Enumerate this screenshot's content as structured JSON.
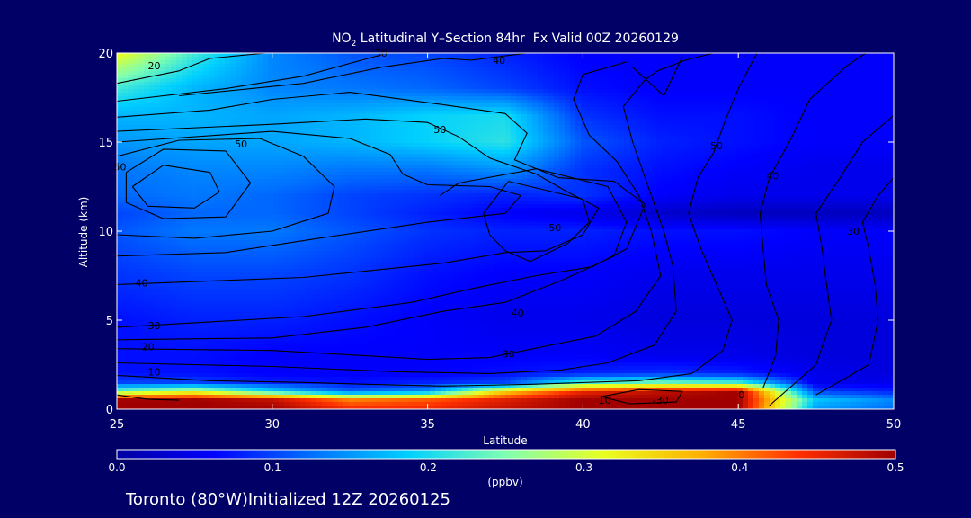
{
  "chart_data": {
    "type": "heatmap",
    "title_prefix": "NO",
    "title_sub": "2",
    "title_rest": " Latitudinal Y–Section 84hr  Fx Valid 00Z 20260129",
    "xlabel": "Latitude",
    "ylabel": "Altitude (km)",
    "xlim": [
      25,
      50
    ],
    "ylim": [
      0,
      20
    ],
    "x_ticks": [
      25,
      30,
      35,
      40,
      45,
      50
    ],
    "y_ticks": [
      0,
      5,
      10,
      15,
      20
    ],
    "colorbar": {
      "min": 0.0,
      "max": 0.5,
      "ticks": [
        "0.0",
        "0.1",
        "0.2",
        "0.3",
        "0.4",
        "0.5"
      ],
      "unit": "(ppbv)",
      "colors": [
        "#0000a0",
        "#0000ff",
        "#0070ff",
        "#00d0ff",
        "#80ffb0",
        "#e8ff20",
        "#ffb000",
        "#ff3000",
        "#a00000"
      ]
    },
    "field_grid": {
      "lats": [
        25,
        27.5,
        30,
        32.5,
        35,
        37.5,
        40,
        42.5,
        45,
        47.5,
        50
      ],
      "alts": [
        0,
        0.5,
        1,
        1.5,
        2,
        3,
        5,
        7.5,
        10,
        11,
        12,
        13.5,
        15,
        16.5,
        18,
        20
      ],
      "values": [
        [
          0.5,
          0.5,
          0.5,
          0.45,
          0.45,
          0.48,
          0.5,
          0.5,
          0.5,
          0.15,
          0.12
        ],
        [
          0.5,
          0.5,
          0.48,
          0.4,
          0.42,
          0.46,
          0.5,
          0.5,
          0.5,
          0.18,
          0.14
        ],
        [
          0.25,
          0.3,
          0.2,
          0.12,
          0.15,
          0.35,
          0.45,
          0.48,
          0.5,
          0.1,
          0.08
        ],
        [
          0.1,
          0.1,
          0.08,
          0.07,
          0.08,
          0.1,
          0.22,
          0.24,
          0.22,
          0.05,
          0.05
        ],
        [
          0.07,
          0.07,
          0.06,
          0.06,
          0.06,
          0.07,
          0.08,
          0.09,
          0.08,
          0.05,
          0.04
        ],
        [
          0.07,
          0.07,
          0.06,
          0.06,
          0.06,
          0.06,
          0.06,
          0.05,
          0.05,
          0.04,
          0.04
        ],
        [
          0.07,
          0.08,
          0.08,
          0.07,
          0.06,
          0.05,
          0.05,
          0.04,
          0.04,
          0.04,
          0.04
        ],
        [
          0.09,
          0.1,
          0.1,
          0.09,
          0.07,
          0.06,
          0.06,
          0.05,
          0.05,
          0.05,
          0.05
        ],
        [
          0.11,
          0.13,
          0.13,
          0.11,
          0.09,
          0.08,
          0.08,
          0.07,
          0.07,
          0.06,
          0.06
        ],
        [
          0.1,
          0.12,
          0.12,
          0.1,
          0.08,
          0.06,
          0.05,
          0.03,
          0.02,
          0.02,
          0.02
        ],
        [
          0.12,
          0.13,
          0.12,
          0.1,
          0.09,
          0.08,
          0.09,
          0.06,
          0.05,
          0.05,
          0.05
        ],
        [
          0.13,
          0.14,
          0.14,
          0.13,
          0.13,
          0.15,
          0.09,
          0.07,
          0.06,
          0.05,
          0.05
        ],
        [
          0.15,
          0.16,
          0.16,
          0.17,
          0.19,
          0.21,
          0.11,
          0.08,
          0.07,
          0.06,
          0.06
        ],
        [
          0.17,
          0.17,
          0.16,
          0.17,
          0.19,
          0.2,
          0.09,
          0.07,
          0.07,
          0.06,
          0.06
        ],
        [
          0.22,
          0.17,
          0.14,
          0.13,
          0.12,
          0.1,
          0.07,
          0.06,
          0.06,
          0.06,
          0.06
        ],
        [
          0.32,
          0.22,
          0.14,
          0.11,
          0.1,
          0.08,
          0.06,
          0.06,
          0.06,
          0.06,
          0.06
        ]
      ]
    },
    "contour_labels": [
      {
        "text": "20",
        "lat": 26.2,
        "alt": 19.3
      },
      {
        "text": "30",
        "lat": 33.5,
        "alt": 20.0
      },
      {
        "text": "40",
        "lat": 37.3,
        "alt": 19.6
      },
      {
        "text": "50",
        "lat": 29.0,
        "alt": 14.9
      },
      {
        "text": "50",
        "lat": 35.4,
        "alt": 15.7
      },
      {
        "text": "50",
        "lat": 39.1,
        "alt": 10.2
      },
      {
        "text": "50",
        "lat": 25.1,
        "alt": 13.6
      },
      {
        "text": "40",
        "lat": 25.8,
        "alt": 7.1
      },
      {
        "text": "30",
        "lat": 26.2,
        "alt": 4.7
      },
      {
        "text": "20",
        "lat": 26.0,
        "alt": 3.5
      },
      {
        "text": "10",
        "lat": 26.2,
        "alt": 2.1
      },
      {
        "text": "40",
        "lat": 37.9,
        "alt": 5.4
      },
      {
        "text": "30",
        "lat": 37.6,
        "alt": 3.1
      },
      {
        "text": "10",
        "lat": 40.7,
        "alt": 0.5
      },
      {
        "text": "-30",
        "lat": 42.5,
        "alt": 0.5
      },
      {
        "text": "0",
        "lat": 45.1,
        "alt": 0.8
      },
      {
        "text": "50",
        "lat": 44.3,
        "alt": 14.8
      },
      {
        "text": "40",
        "lat": 46.1,
        "alt": 13.1
      },
      {
        "text": "30",
        "lat": 48.7,
        "alt": 10.0
      }
    ],
    "wind_contours": [
      [
        [
          25.5,
          12.5
        ],
        [
          26.5,
          13.7
        ],
        [
          28,
          13.3
        ],
        [
          28.3,
          12.2
        ],
        [
          27.5,
          11.3
        ],
        [
          26,
          11.4
        ],
        [
          25.5,
          12.5
        ]
      ],
      [
        [
          25.3,
          13.3
        ],
        [
          26.5,
          14.6
        ],
        [
          28.5,
          14.5
        ],
        [
          29.3,
          12.7
        ],
        [
          28.5,
          10.8
        ],
        [
          26.5,
          10.7
        ],
        [
          25.3,
          11.6
        ],
        [
          25.3,
          13.3
        ]
      ],
      [
        [
          25,
          14.2
        ],
        [
          27,
          15.1
        ],
        [
          29.6,
          15.2
        ],
        [
          31,
          14.2
        ],
        [
          32,
          12.5
        ],
        [
          31.8,
          11
        ],
        [
          30,
          10
        ],
        [
          27.5,
          9.6
        ],
        [
          25,
          9.8
        ]
      ],
      [
        [
          25,
          15
        ],
        [
          30,
          15.6
        ],
        [
          32.5,
          15.2
        ],
        [
          33.8,
          14.3
        ],
        [
          34.2,
          13.2
        ],
        [
          35,
          12.6
        ],
        [
          37,
          12.5
        ],
        [
          38,
          12
        ],
        [
          37.5,
          11
        ],
        [
          35,
          10.5
        ],
        [
          31.5,
          9.6
        ],
        [
          28.5,
          8.8
        ],
        [
          25,
          8.6
        ]
      ],
      [
        [
          25,
          15.6
        ],
        [
          30,
          16
        ],
        [
          33,
          16.3
        ],
        [
          35,
          16.1
        ],
        [
          36,
          15.3
        ],
        [
          37,
          14.1
        ],
        [
          38.5,
          13.2
        ],
        [
          39.5,
          12.2
        ],
        [
          40.5,
          11.3
        ],
        [
          40,
          9.8
        ],
        [
          38.8,
          8.9
        ],
        [
          37.5,
          8.8
        ],
        [
          35.5,
          8.2
        ],
        [
          31,
          7.4
        ],
        [
          25,
          7.0
        ]
      ],
      [
        [
          25,
          16.4
        ],
        [
          28,
          16.8
        ],
        [
          30,
          17.4
        ],
        [
          32.5,
          17.8
        ],
        [
          35.5,
          17.1
        ],
        [
          37.5,
          16.6
        ],
        [
          38.2,
          15.5
        ],
        [
          37.8,
          14.0
        ],
        [
          39.2,
          13.0
        ],
        [
          41,
          12.8
        ],
        [
          42,
          11.5
        ],
        [
          41.4,
          9.0
        ],
        [
          40.3,
          8.0
        ],
        [
          38.5,
          7.5
        ],
        [
          36.5,
          6.8
        ],
        [
          34.5,
          6.0
        ],
        [
          31,
          5.2
        ],
        [
          25,
          4.6
        ]
      ],
      [
        [
          25,
          17.3
        ],
        [
          28.5,
          18
        ],
        [
          31,
          18.7
        ],
        [
          33.5,
          19.9
        ]
      ],
      [
        [
          27,
          17.6
        ],
        [
          31,
          18.3
        ],
        [
          33.5,
          19.2
        ],
        [
          35.5,
          19.7
        ],
        [
          36.4,
          19.6
        ],
        [
          38.2,
          20.0
        ]
      ],
      [
        [
          25,
          18.3
        ],
        [
          27,
          19.0
        ],
        [
          28,
          19.7
        ],
        [
          29.8,
          20.0
        ]
      ],
      [
        [
          37.6,
          12.8
        ],
        [
          38.8,
          12.3
        ],
        [
          40,
          11.8
        ],
        [
          40.2,
          10.5
        ],
        [
          39.5,
          9.3
        ],
        [
          38.3,
          8.3
        ],
        [
          37.5,
          8.9
        ],
        [
          37.0,
          9.8
        ],
        [
          36.8,
          11.0
        ],
        [
          37.6,
          12.8
        ]
      ],
      [
        [
          35.4,
          12.0
        ],
        [
          36.0,
          12.7
        ],
        [
          38.5,
          13.5
        ],
        [
          40.8,
          12.5
        ],
        [
          41.4,
          10.5
        ],
        [
          41.0,
          8.6
        ],
        [
          39.4,
          7.3
        ],
        [
          37.5,
          6.0
        ],
        [
          35.5,
          5.5
        ],
        [
          33,
          4.6
        ],
        [
          30,
          4.0
        ],
        [
          25,
          3.9
        ]
      ],
      [
        [
          25,
          3.4
        ],
        [
          30,
          3.3
        ],
        [
          33,
          3.0
        ],
        [
          35,
          2.8
        ],
        [
          37,
          2.9
        ],
        [
          38.4,
          3.4
        ],
        [
          40.4,
          4.1
        ],
        [
          41.7,
          5.5
        ],
        [
          42.5,
          7.5
        ],
        [
          42.2,
          10.0
        ],
        [
          41.8,
          12.0
        ],
        [
          41.1,
          13.9
        ],
        [
          40.2,
          15.4
        ],
        [
          39.7,
          17.4
        ],
        [
          40.0,
          18.8
        ],
        [
          41.4,
          19.5
        ]
      ],
      [
        [
          25,
          2.6
        ],
        [
          30,
          2.4
        ],
        [
          34,
          2.1
        ],
        [
          37,
          2.0
        ],
        [
          39.3,
          2.2
        ],
        [
          40.8,
          2.6
        ],
        [
          42.3,
          3.6
        ],
        [
          43.0,
          5.5
        ],
        [
          42.9,
          8.0
        ],
        [
          42.6,
          10.0
        ],
        [
          42.0,
          13.0
        ],
        [
          41.6,
          15.0
        ],
        [
          41.3,
          17.0
        ],
        [
          42.0,
          18.5
        ],
        [
          42.4,
          19.0
        ],
        [
          43.3,
          19.6
        ],
        [
          44.2,
          20.0
        ]
      ],
      [
        [
          25,
          1.9
        ],
        [
          28,
          1.6
        ],
        [
          31,
          1.5
        ],
        [
          33,
          1.4
        ],
        [
          35.5,
          1.3
        ],
        [
          38.4,
          1.4
        ],
        [
          41.8,
          1.6
        ],
        [
          43.5,
          2.0
        ],
        [
          44.5,
          3.3
        ],
        [
          44.8,
          5.0
        ],
        [
          44.3,
          7.0
        ],
        [
          43.8,
          9.0
        ],
        [
          43.4,
          11.0
        ],
        [
          43.7,
          13.0
        ],
        [
          44.2,
          14.4
        ],
        [
          44.6,
          16.3
        ],
        [
          45.0,
          18.0
        ],
        [
          45.6,
          20.0
        ]
      ],
      [
        [
          45.8,
          1.2
        ],
        [
          46.2,
          3.0
        ],
        [
          46.3,
          5.0
        ],
        [
          45.9,
          7.0
        ],
        [
          45.8,
          9.0
        ],
        [
          45.7,
          11.0
        ],
        [
          46.0,
          13.0
        ],
        [
          46.7,
          15.2
        ],
        [
          47.3,
          17.4
        ],
        [
          48.5,
          19.3
        ],
        [
          49.1,
          20.0
        ]
      ],
      [
        [
          46.0,
          0.2
        ],
        [
          47.5,
          2.5
        ],
        [
          48.0,
          5.0
        ],
        [
          47.8,
          7.5
        ],
        [
          47.7,
          9.0
        ],
        [
          47.5,
          11.0
        ],
        [
          48.2,
          12.8
        ],
        [
          49.0,
          15.0
        ],
        [
          50,
          16.5
        ]
      ],
      [
        [
          47.5,
          0.8
        ],
        [
          49.2,
          2.5
        ],
        [
          49.5,
          5.0
        ],
        [
          49.4,
          7.0
        ],
        [
          49.2,
          9.0
        ],
        [
          49.0,
          10.5
        ],
        [
          49.5,
          12.0
        ],
        [
          50,
          13.0
        ]
      ],
      [
        [
          41.6,
          19.2
        ],
        [
          42.6,
          17.6
        ],
        [
          43.2,
          19.8
        ]
      ],
      [
        [
          43.2,
          1.0
        ],
        [
          41.8,
          1.1
        ],
        [
          40.6,
          0.7
        ],
        [
          41.5,
          0.3
        ],
        [
          43.0,
          0.4
        ],
        [
          43.2,
          1.0
        ]
      ],
      [
        [
          25,
          0.8
        ],
        [
          26,
          0.55
        ],
        [
          27,
          0.5
        ]
      ]
    ]
  },
  "footer": {
    "location": "Toronto (80°W)",
    "initialized": "Initialized 12Z 20260125"
  }
}
